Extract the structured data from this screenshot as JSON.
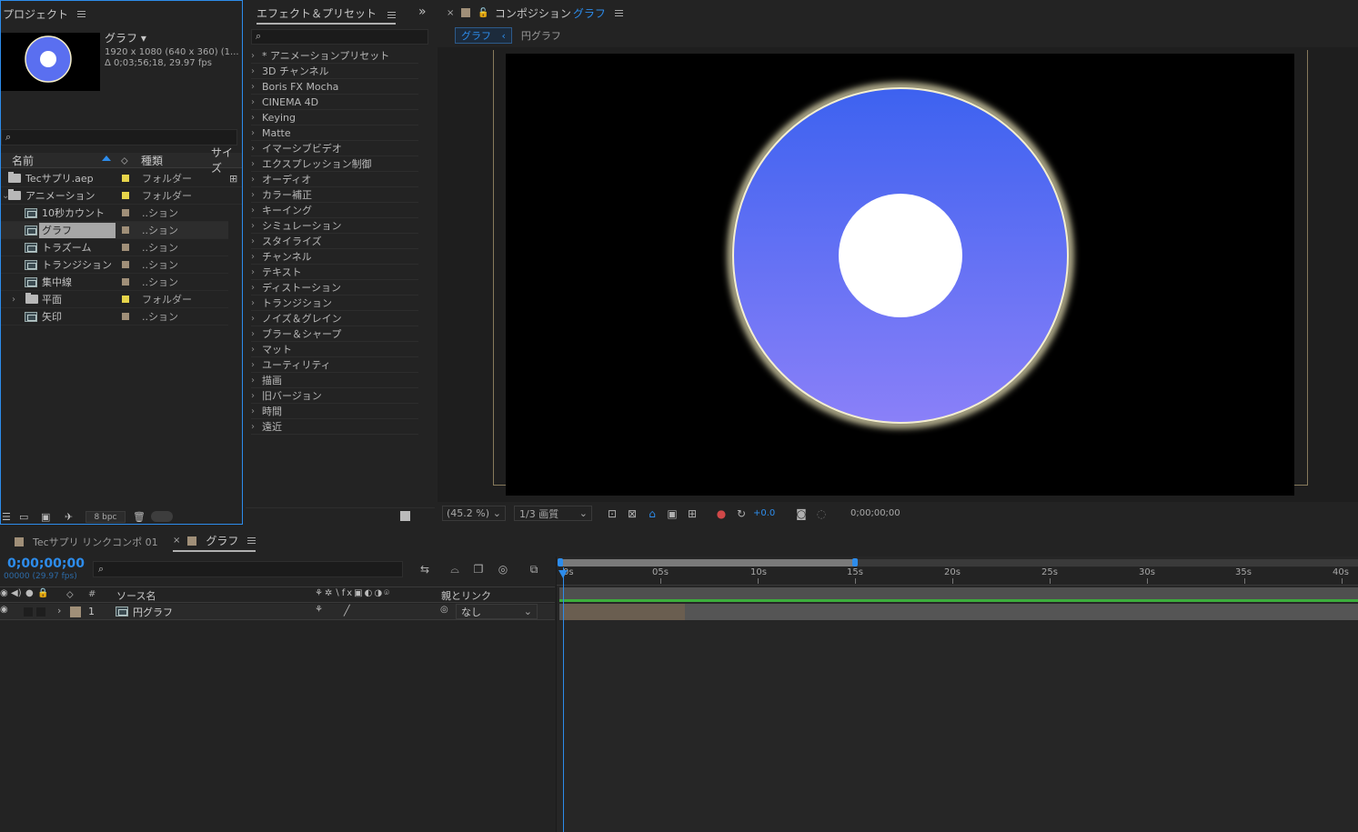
{
  "project": {
    "title": "プロジェクト",
    "preview": {
      "name": "グラフ ▾",
      "info1": "1920 x 1080  (640 x 360) (1...",
      "info2": "Δ 0;03;56;18, 29.97 fps"
    },
    "columns": {
      "name": "名前",
      "type": "種類",
      "size": "サイズ"
    },
    "items": [
      {
        "name": "Tecサプリ.aep",
        "type": "フォルダー",
        "color": "#e6d44a",
        "kind": "folder"
      },
      {
        "name": "アニメーション",
        "type": "フォルダー",
        "color": "#e6d44a",
        "kind": "folder"
      },
      {
        "name": "10秒カウント",
        "type": "..ション",
        "color": "#a08f78",
        "kind": "comp"
      },
      {
        "name": "グラフ",
        "type": "..ション",
        "color": "#a08f78",
        "kind": "comp"
      },
      {
        "name": "トラズーム",
        "type": "..ション",
        "color": "#a08f78",
        "kind": "comp"
      },
      {
        "name": "トランジション",
        "type": "..ション",
        "color": "#a08f78",
        "kind": "comp"
      },
      {
        "name": "集中線",
        "type": "..ション",
        "color": "#a08f78",
        "kind": "comp"
      },
      {
        "name": "平面",
        "type": "フォルダー",
        "color": "#e6d44a",
        "kind": "folder"
      },
      {
        "name": "矢印",
        "type": "..ション",
        "color": "#a08f78",
        "kind": "comp"
      }
    ],
    "bpc": "8 bpc"
  },
  "effects": {
    "title": "エフェクト＆プリセット",
    "items": [
      "* アニメーションプリセット",
      "3D チャンネル",
      "Boris FX Mocha",
      "CINEMA 4D",
      "Keying",
      "Matte",
      "イマーシブビデオ",
      "エクスプレッション制御",
      "オーディオ",
      "カラー補正",
      "キーイング",
      "シミュレーション",
      "スタイライズ",
      "チャンネル",
      "テキスト",
      "ディストーション",
      "トランジション",
      "ノイズ＆グレイン",
      "ブラー＆シャープ",
      "マット",
      "ユーティリティ",
      "描画",
      "旧バージョン",
      "時間",
      "遠近"
    ]
  },
  "composition": {
    "tab_prefix": "コンポジション",
    "tab_name": "グラフ",
    "breadcrumb_active": "グラフ",
    "breadcrumb_next": "円グラフ",
    "zoom": "(45.2 %)",
    "resolution": "1/3 画質",
    "exposure": "+0.0",
    "timecode": "0;00;00;00",
    "colors": {
      "ring_top": "#3d62f0",
      "ring_bottom": "#8a80f8",
      "glow": "#f3ecc0"
    }
  },
  "timeline": {
    "tabs": [
      {
        "label": "Tecサプリ リンクコンポ 01",
        "color": "#a08f78"
      },
      {
        "label": "グラフ",
        "color": "#a08f78"
      }
    ],
    "timecode": "0;00;00;00",
    "fps": "00000 (29.97 fps)",
    "columns": {
      "num": "#",
      "source": "ソース名",
      "parent": "親とリンク"
    },
    "layers": [
      {
        "num": "1",
        "name": "円グラフ",
        "parent": "なし",
        "color": "#a08f78"
      }
    ],
    "ruler": [
      "0s",
      "05s",
      "10s",
      "15s",
      "20s",
      "25s",
      "30s",
      "35s",
      "40s"
    ]
  }
}
